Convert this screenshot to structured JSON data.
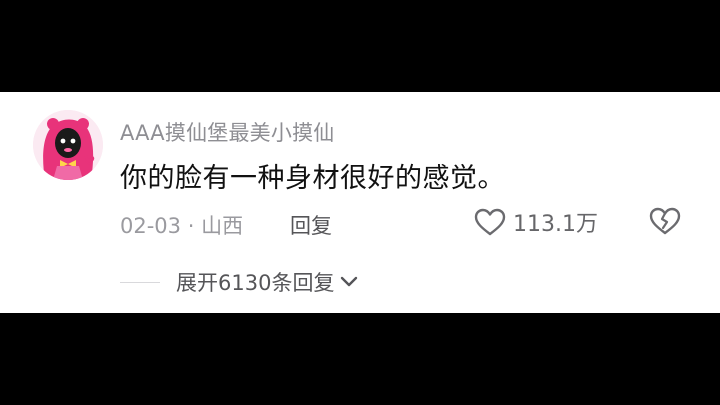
{
  "comment": {
    "username": "AAA摸仙堡最美小摸仙",
    "text": "你的脸有一种身材很好的感觉。",
    "date": "02-03",
    "separator": "·",
    "location": "山西",
    "reply_label": "回复",
    "like_count": "113.1万",
    "expand_replies_label": "展开6130条回复"
  },
  "icons": {
    "like": "heart-outline-icon",
    "dislike": "broken-heart-icon",
    "expand": "chevron-down-icon"
  },
  "colors": {
    "background": "#ffffff",
    "letterbox": "#000000",
    "username": "#8e8e93",
    "text": "#111111",
    "meta": "#9a9a9f",
    "avatar_hair": "#e8337a"
  }
}
